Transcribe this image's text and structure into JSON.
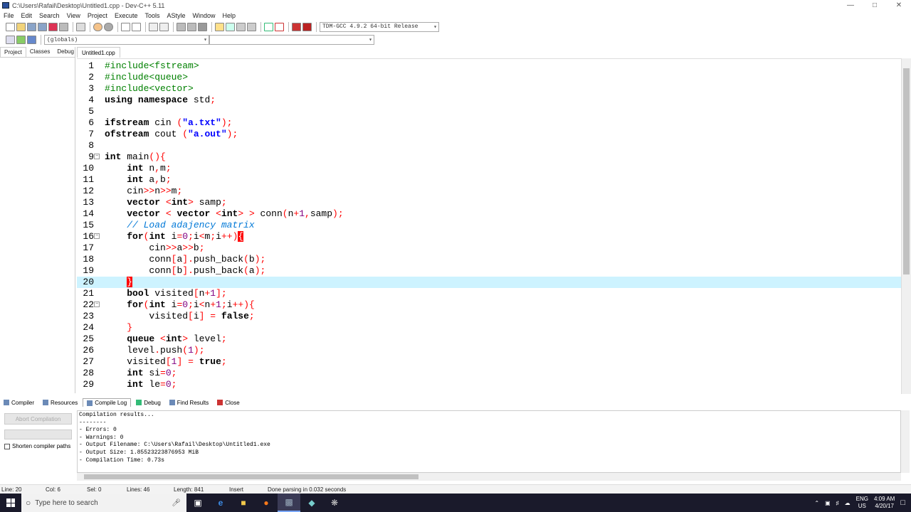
{
  "window": {
    "title": "C:\\Users\\Rafail\\Desktop\\Untitled1.cpp - Dev-C++ 5.11"
  },
  "menu": [
    "File",
    "Edit",
    "Search",
    "View",
    "Project",
    "Execute",
    "Tools",
    "AStyle",
    "Window",
    "Help"
  ],
  "toolbar": {
    "compiler_select": "TDM-GCC 4.9.2 64-bit Release",
    "scope_select": "(globals)"
  },
  "left_tabs": [
    "Project",
    "Classes",
    "Debug"
  ],
  "editor_tabs": [
    "Untitled1.cpp"
  ],
  "code_lines": [
    "#include<fstream>",
    "#include<queue>",
    "#include<vector>",
    "using namespace std;",
    "",
    "ifstream cin (\"a.txt\");",
    "ofstream cout (\"a.out\");",
    "",
    "int main(){",
    "    int n,m;",
    "    int a,b;",
    "    cin>>n>>m;",
    "    vector <int> samp;",
    "    vector < vector <int> > conn(n+1,samp);",
    "    // Load adajency matrix",
    "    for(int i=0;i<m;i++){",
    "        cin>>a>>b;",
    "        conn[a].push_back(b);",
    "        conn[b].push_back(a);",
    "    }",
    "    bool visited[n+1];",
    "    for(int i=0;i<n+1;i++){",
    "        visited[i] = false;",
    "    }",
    "    queue <int> level;",
    "    level.push(1);",
    "    visited[1] = true;",
    "    int si=0;",
    "    int le=0;"
  ],
  "current_line": 20,
  "bottom_tabs": [
    "Compiler",
    "Resources",
    "Compile Log",
    "Debug",
    "Find Results",
    "Close"
  ],
  "bottom_panel": {
    "abort_label": "Abort Compilation",
    "shorten_label": "Shorten compiler paths",
    "log": [
      "Compilation results...",
      "--------",
      "- Errors: 0",
      "- Warnings: 0",
      "- Output Filename: C:\\Users\\Rafail\\Desktop\\Untitled1.exe",
      "- Output Size: 1.85523223876953 MiB",
      "- Compilation Time: 0.73s"
    ]
  },
  "status": {
    "line": "Line:   20",
    "col": "Col:   6",
    "sel": "Sel:   0",
    "lines": "Lines:   46",
    "length": "Length:   841",
    "mode": "Insert",
    "message": "Done parsing in 0.032 seconds"
  },
  "taskbar": {
    "search_placeholder": "Type here to search",
    "lang": "ENG",
    "region": "US",
    "time": "4:09 AM",
    "date": "4/20/17"
  }
}
